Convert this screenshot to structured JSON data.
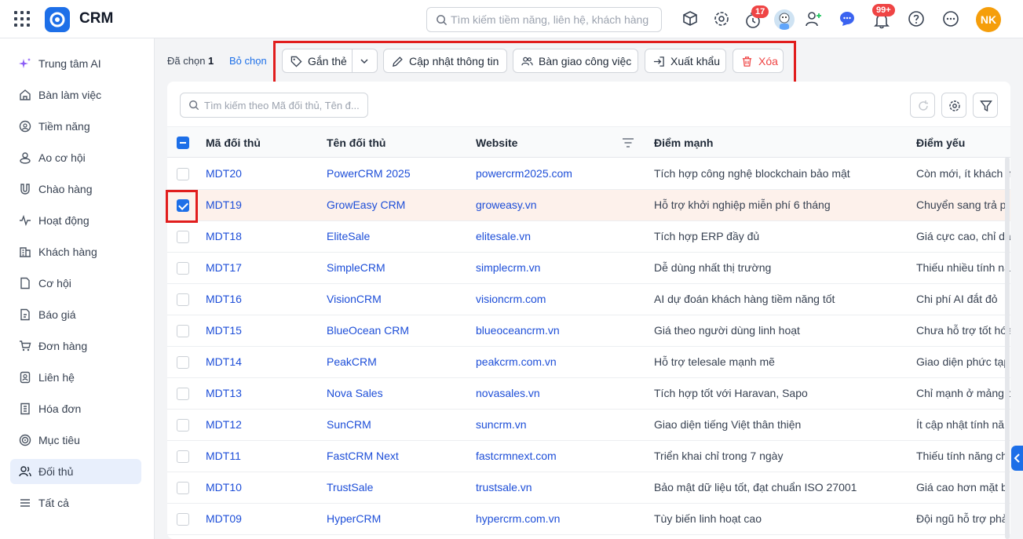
{
  "header": {
    "app_title": "CRM",
    "search_placeholder": "Tìm kiếm tiềm năng, liên hệ, khách hàng",
    "badge_timer": "17",
    "badge_notifications": "99+",
    "user_initials": "NK"
  },
  "sidebar": {
    "items": [
      {
        "label": "Trung tâm AI",
        "icon": "sparkle-icon"
      },
      {
        "label": "Bàn làm việc",
        "icon": "home-icon"
      },
      {
        "label": "Tiềm năng",
        "icon": "target-person-icon"
      },
      {
        "label": "Ao cơ hội",
        "icon": "people-pool-icon"
      },
      {
        "label": "Chào hàng",
        "icon": "magnet-icon"
      },
      {
        "label": "Hoạt động",
        "icon": "activity-icon"
      },
      {
        "label": "Khách hàng",
        "icon": "building-icon"
      },
      {
        "label": "Cơ hội",
        "icon": "document-icon"
      },
      {
        "label": "Báo giá",
        "icon": "quote-icon"
      },
      {
        "label": "Đơn hàng",
        "icon": "cart-icon"
      },
      {
        "label": "Liên hệ",
        "icon": "contact-icon"
      },
      {
        "label": "Hóa đơn",
        "icon": "invoice-icon"
      },
      {
        "label": "Mục tiêu",
        "icon": "goal-icon"
      },
      {
        "label": "Đối thủ",
        "icon": "competitor-icon"
      },
      {
        "label": "Tất cả",
        "icon": "menu-icon"
      }
    ],
    "active_index": 13
  },
  "selection": {
    "prefix": "Đã chọn",
    "count": "1",
    "unselect_label": "Bỏ chọn"
  },
  "actions": {
    "tag_label": "Gắn thẻ",
    "update_label": "Cập nhật thông tin",
    "handover_label": "Bàn giao công việc",
    "export_label": "Xuất khẩu",
    "delete_label": "Xóa"
  },
  "table": {
    "search_placeholder": "Tìm kiếm theo Mã đối thủ, Tên đ...",
    "columns": [
      "Mã đối thủ",
      "Tên đối thủ",
      "Website",
      "Điểm mạnh",
      "Điểm yếu"
    ],
    "rows": [
      {
        "code": "MDT20",
        "name": "PowerCRM 2025",
        "website": "powercrm2025.com",
        "strength": "Tích hợp công nghệ blockchain bảo mật",
        "weakness": "Còn mới, ít khách h",
        "checked": false
      },
      {
        "code": "MDT19",
        "name": "GrowEasy CRM",
        "website": "groweasy.vn",
        "strength": "Hỗ trợ khởi nghiệp miễn phí 6 tháng",
        "weakness": "Chuyển sang trả p",
        "checked": true
      },
      {
        "code": "MDT18",
        "name": "EliteSale",
        "website": "elitesale.vn",
        "strength": "Tích hợp ERP đầy đủ",
        "weakness": "Giá cực cao, chỉ dà",
        "checked": false
      },
      {
        "code": "MDT17",
        "name": "SimpleCRM",
        "website": "simplecrm.vn",
        "strength": "Dễ dùng nhất thị trường",
        "weakness": "Thiếu nhiều tính nă",
        "checked": false
      },
      {
        "code": "MDT16",
        "name": "VisionCRM",
        "website": "visioncrm.com",
        "strength": "AI dự đoán khách hàng tiềm năng tốt",
        "weakness": "Chi phí AI đắt đỏ",
        "checked": false
      },
      {
        "code": "MDT15",
        "name": "BlueOcean CRM",
        "website": "blueoceancrm.vn",
        "strength": "Giá theo người dùng linh hoạt",
        "weakness": "Chưa hỗ trợ tốt hóa",
        "checked": false
      },
      {
        "code": "MDT14",
        "name": "PeakCRM",
        "website": "peakcrm.com.vn",
        "strength": "Hỗ trợ telesale mạnh mẽ",
        "weakness": "Giao diện phức tạp",
        "checked": false
      },
      {
        "code": "MDT13",
        "name": "Nova Sales",
        "website": "novasales.vn",
        "strength": "Tích hợp tốt với Haravan, Sapo",
        "weakness": "Chỉ mạnh ở mảng b",
        "checked": false
      },
      {
        "code": "MDT12",
        "name": "SunCRM",
        "website": "suncrm.vn",
        "strength": "Giao diện tiếng Việt thân thiện",
        "weakness": "Ít cập nhật tính năn",
        "checked": false
      },
      {
        "code": "MDT11",
        "name": "FastCRM Next",
        "website": "fastcrmnext.com",
        "strength": "Triển khai chỉ trong 7 ngày",
        "weakness": "Thiếu tính năng ch",
        "checked": false
      },
      {
        "code": "MDT10",
        "name": "TrustSale",
        "website": "trustsale.vn",
        "strength": "Bảo mật dữ liệu tốt, đạt chuẩn ISO 27001",
        "weakness": "Giá cao hơn mặt b",
        "checked": false
      },
      {
        "code": "MDT09",
        "name": "HyperCRM",
        "website": "hypercrm.com.vn",
        "strength": "Tùy biến linh hoạt cao",
        "weakness": "Đội ngũ hỗ trợ phả",
        "checked": false
      }
    ]
  },
  "colors": {
    "accent": "#1d6fe8",
    "link": "#1d4ed8",
    "danger": "#ef4444",
    "highlight_box": "#e11d1d",
    "selected_row": "#fdf1eb"
  }
}
